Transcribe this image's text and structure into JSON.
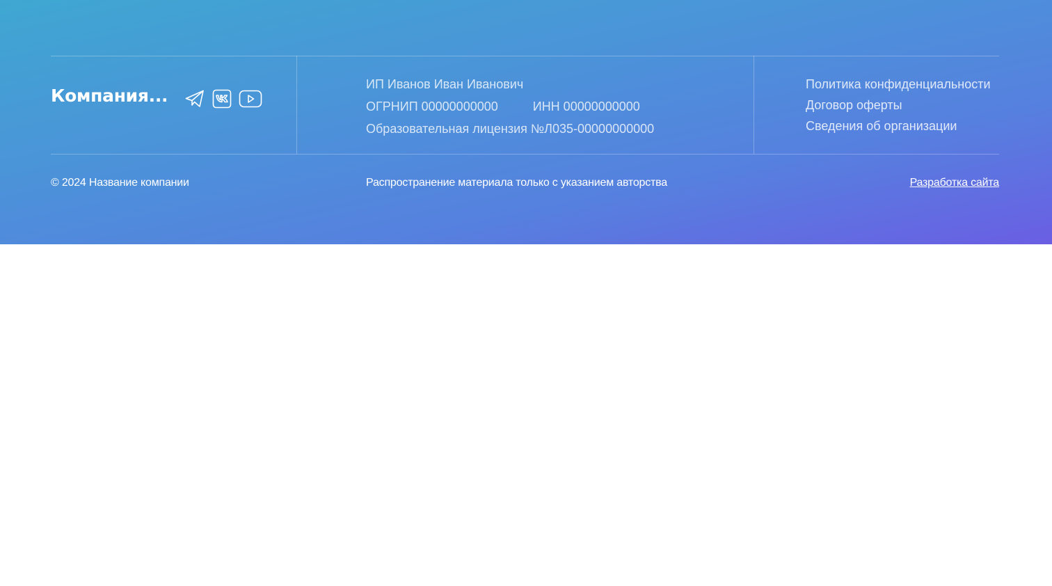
{
  "footer": {
    "brand": "Компания...",
    "socials": [
      {
        "name": "telegram",
        "icon": "telegram-icon"
      },
      {
        "name": "vk",
        "icon": "vk-icon"
      },
      {
        "name": "youtube",
        "icon": "youtube-icon"
      }
    ],
    "legal": {
      "owner": "ИП Иванов Иван Иванович",
      "ogrnip": "ОГРНИП 00000000000",
      "inn": "ИНН 00000000000",
      "license": "Образовательная лицензия №Л035-00000000000"
    },
    "links": [
      {
        "label": "Политика конфиденциальности"
      },
      {
        "label": "Договор оферты"
      },
      {
        "label": "Сведения об организации"
      }
    ],
    "bottom": {
      "copyright": "© 2024 Название компании",
      "notice": "Распространение материала только с указанием авторства",
      "developer_link": "Разработка сайта"
    }
  },
  "colors": {
    "gradient_start": "#3fa7d1",
    "gradient_end": "#6a5ee3",
    "page_background": "#ffffff",
    "text": "#ffffff"
  }
}
